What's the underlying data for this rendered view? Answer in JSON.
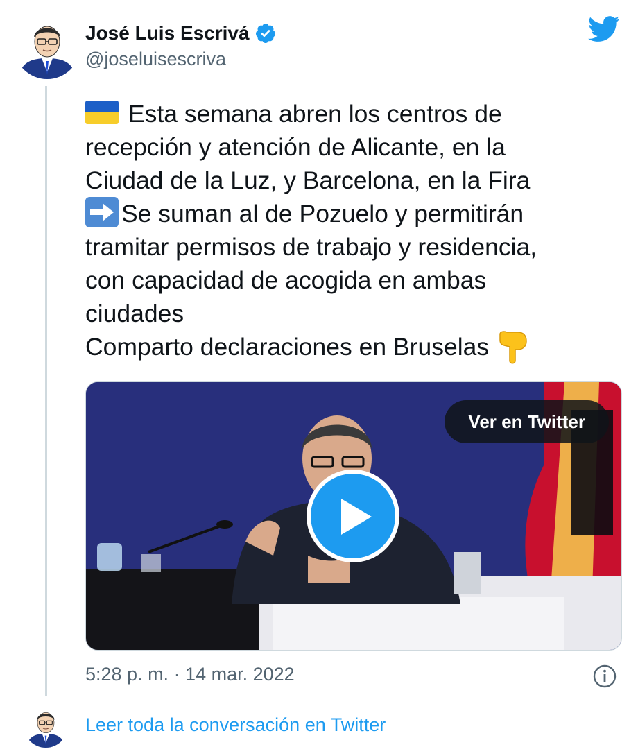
{
  "author": {
    "display_name": "José Luis Escrivá",
    "handle": "@joseluisescriva",
    "verified": true,
    "avatar_icon": "man-with-glasses-illustration-icon"
  },
  "platform_icon": "twitter-bird-icon",
  "tweet": {
    "lines": [
      "Esta semana abren los centros de",
      "recepción y atención de Alicante, en la",
      "Ciudad de la Luz, y Barcelona, en la Fira",
      "Se suman al de Pozuelo y permitirán",
      "tramitar permisos de trabajo y residencia,",
      "con capacidad de acogida en ambas",
      "ciudades",
      "Comparto declaraciones en Bruselas"
    ],
    "emojis": [
      "ukraine-flag-emoji",
      "right-arrow-emoji",
      "backhand-index-pointing-down-emoji"
    ]
  },
  "media": {
    "type": "video",
    "ver_button_label": "Ver en Twitter",
    "play_icon": "play-icon"
  },
  "timestamp": "5:28 p. m. · 14 mar. 2022",
  "info_icon": "info-icon",
  "read_conversation_link": "Leer toda la conversación en Twitter",
  "colors": {
    "accent": "#1d9bf0",
    "text": "#0f1419",
    "secondary_text": "#536471",
    "border": "#cfd9de"
  }
}
